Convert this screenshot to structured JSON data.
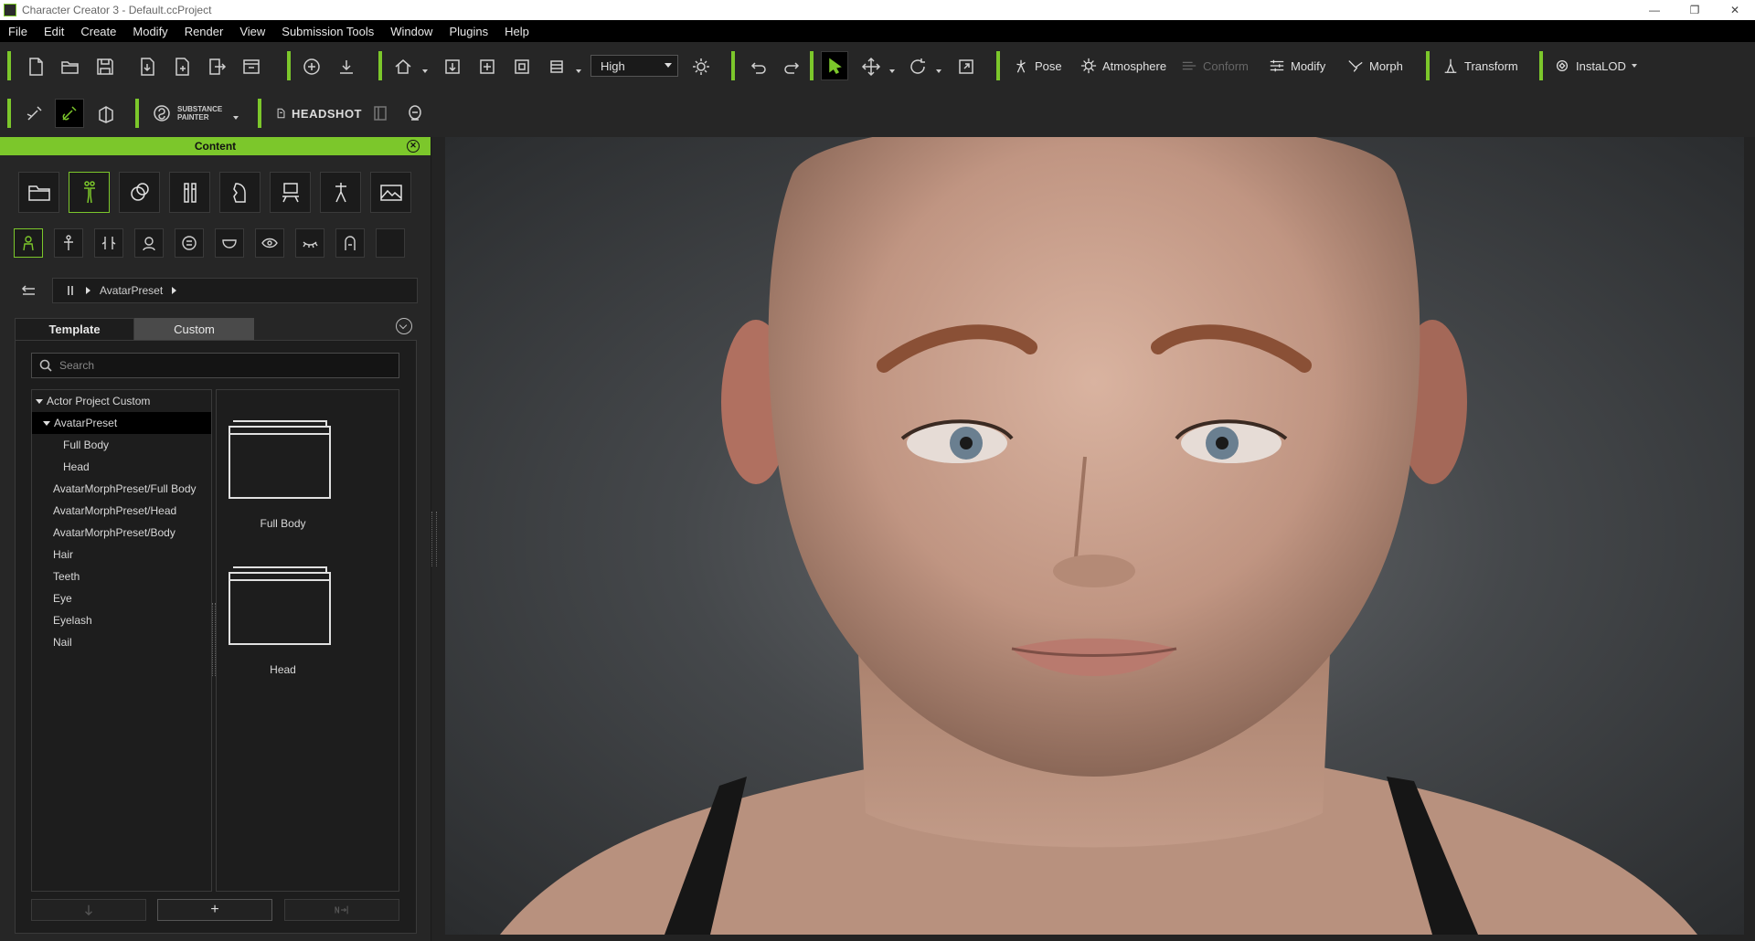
{
  "window": {
    "title": "Character Creator 3 - Default.ccProject",
    "minimize": "—",
    "restore": "❐",
    "close": "✕"
  },
  "menu": [
    "File",
    "Edit",
    "Create",
    "Modify",
    "Render",
    "View",
    "Submission Tools",
    "Window",
    "Plugins",
    "Help"
  ],
  "toolbar": {
    "quality": "High",
    "pose": "Pose",
    "atmosphere": "Atmosphere",
    "conform": "Conform",
    "modify": "Modify",
    "morph": "Morph",
    "transform": "Transform",
    "instalod": "InstaLOD",
    "substance_line1": "SUBSTANCE",
    "substance_line2": "PAINTER",
    "headshot": "HEADSHOT"
  },
  "panel": {
    "title": "Content",
    "breadcrumb": "AvatarPreset",
    "tabs": {
      "template": "Template",
      "custom": "Custom"
    },
    "search_placeholder": "Search",
    "tree": [
      {
        "label": "Actor Project Custom",
        "level": 0,
        "expanded": true
      },
      {
        "label": "AvatarPreset",
        "level": 1,
        "expanded": true,
        "selected": true
      },
      {
        "label": "Full Body",
        "level": 2
      },
      {
        "label": "Head",
        "level": 2
      },
      {
        "label": "AvatarMorphPreset/Full Body",
        "level": 1
      },
      {
        "label": "AvatarMorphPreset/Head",
        "level": 1
      },
      {
        "label": "AvatarMorphPreset/Body",
        "level": 1
      },
      {
        "label": "Hair",
        "level": 1
      },
      {
        "label": "Teeth",
        "level": 1
      },
      {
        "label": "Eye",
        "level": 1
      },
      {
        "label": "Eyelash",
        "level": 1
      },
      {
        "label": "Nail",
        "level": 1
      }
    ],
    "folders": [
      "Full Body",
      "Head"
    ],
    "add_button": "+",
    "colors": {
      "accent": "#7cc72b"
    }
  }
}
